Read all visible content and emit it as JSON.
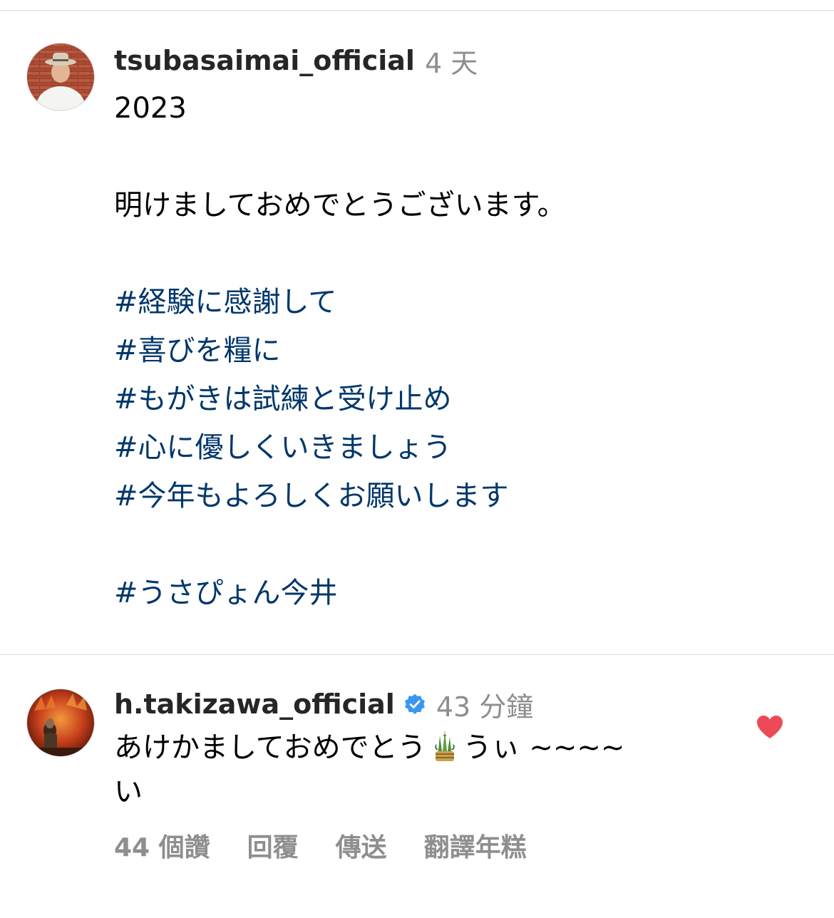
{
  "post": {
    "username": "tsubasaimai_official",
    "timestamp": "4 天",
    "lines": [
      {
        "text": "2023",
        "type": "text"
      },
      {
        "text": "",
        "type": "blank"
      },
      {
        "text": "明けましておめでとうございます。",
        "type": "text"
      },
      {
        "text": "",
        "type": "blank"
      },
      {
        "text": "#経験に感謝して",
        "type": "hashtag"
      },
      {
        "text": "#喜びを糧に",
        "type": "hashtag"
      },
      {
        "text": "#もがきは試練と受け止め",
        "type": "hashtag"
      },
      {
        "text": "#心に優しくいきましょう",
        "type": "hashtag"
      },
      {
        "text": "#今年もよろしくお願いします",
        "type": "hashtag"
      },
      {
        "text": "",
        "type": "blank"
      },
      {
        "text": "#うさぴょん今井",
        "type": "hashtag"
      }
    ]
  },
  "comment": {
    "username": "h.takizawa_official",
    "verified": true,
    "timestamp": "43 分鐘",
    "text_before_emoji": "あけかましておめでとう",
    "emoji": "kadomatsu-icon",
    "text_after_emoji": "うぃ ~~~~",
    "text_line2": "い",
    "liked": true,
    "actions": {
      "likes": "44 個讚",
      "reply": "回覆",
      "send": "傳送",
      "translate": "翻譯年糕"
    }
  },
  "colors": {
    "hashtag": "#00376b",
    "muted": "#8e8e8e",
    "verified": "#3897f0",
    "heart": "#ed4956"
  }
}
